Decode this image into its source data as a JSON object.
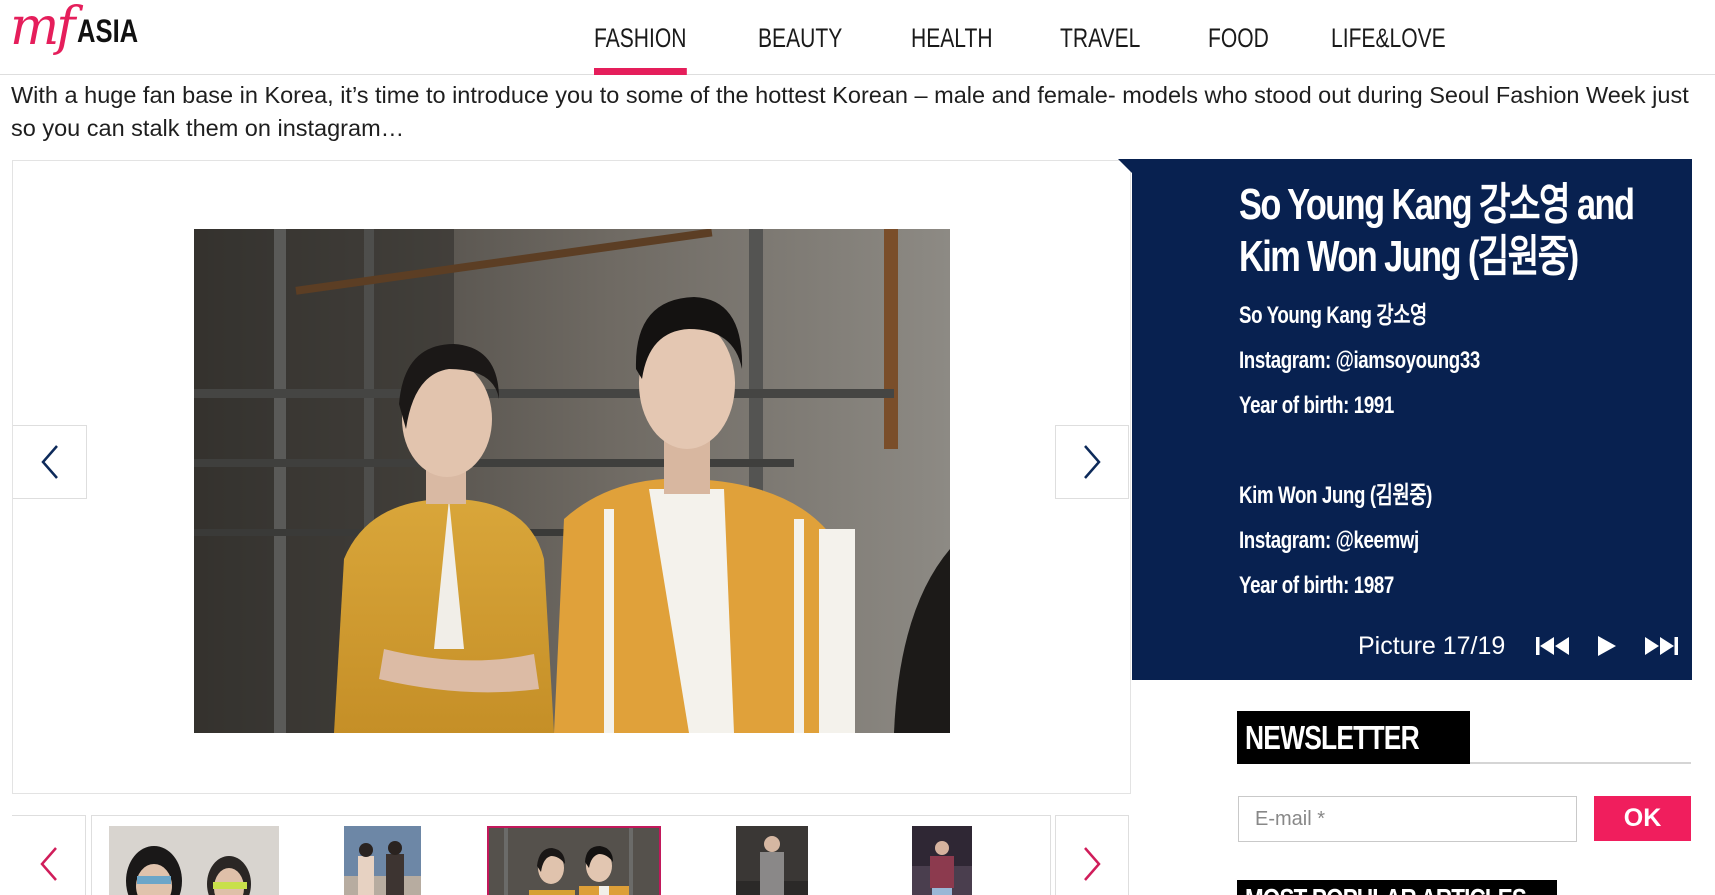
{
  "site": {
    "logo_mf": "mf",
    "logo_region": "ASIA"
  },
  "nav": {
    "items": [
      {
        "label": "FASHION",
        "active": true
      },
      {
        "label": "BEAUTY",
        "active": false
      },
      {
        "label": "HEALTH",
        "active": false
      },
      {
        "label": "TRAVEL",
        "active": false
      },
      {
        "label": "FOOD",
        "active": false
      },
      {
        "label": "LIFE&LOVE",
        "active": false
      }
    ]
  },
  "article": {
    "intro": "With a huge fan base in Korea, it’s time to introduce you to some of the hottest Korean – male and female- models who stood out during Seoul Fashion Week just so you can stalk them on instagram…"
  },
  "slide": {
    "title_line1": "So Young Kang 강소영 and",
    "title_line2": "Kim Won Jung (김원중)",
    "person1_name": "So Young Kang 강소영",
    "person1_instagram": "Instagram: @iamsoyoung33",
    "person1_birth": "Year of birth: 1991",
    "person2_name": "Kim Won Jung (김원중)",
    "person2_instagram": "Instagram: @keemwj",
    "person2_birth": "Year of birth: 1987",
    "counter": "Picture 17/19"
  },
  "newsletter": {
    "title": "NEWSLETTER",
    "email_placeholder": "E-mail *",
    "ok_label": "OK"
  },
  "sidebar": {
    "popular_title": "MOST POPULAR ARTICLES"
  },
  "colors": {
    "brand": "#e51e5b",
    "panel": "#082150",
    "nav_arrow": "#0d2a5a",
    "thumb_arrow": "#d01d5a"
  },
  "icons": {
    "prev": "chevron-left-icon",
    "next": "chevron-right-icon",
    "first": "skip-back-icon",
    "play": "play-icon",
    "last": "skip-forward-icon"
  }
}
